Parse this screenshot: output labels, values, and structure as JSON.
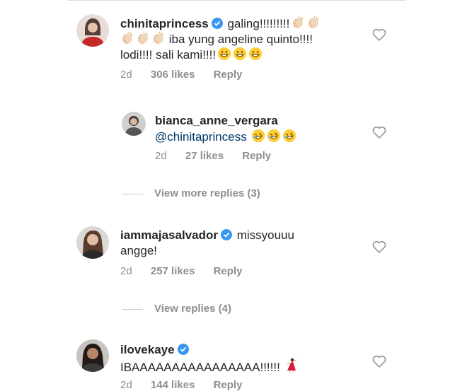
{
  "comments": [
    {
      "username": "chinitaprincess",
      "verified": true,
      "text_line1": "galing!!!!!!!!!",
      "text_line2": "iba yung angeline quinto!!!!",
      "text_line3": "lodi!!!! sali kami!!!!",
      "time": "2d",
      "likes": "306 likes",
      "reply": "Reply"
    },
    {
      "username": "bianca_anne_vergara",
      "verified": false,
      "mention": "@chinitaprincess",
      "time": "2d",
      "likes": "27 likes",
      "reply": "Reply"
    },
    {
      "username": "iammajasalvador",
      "verified": true,
      "text_line1": "missyouuu",
      "text_line2": "angge!",
      "time": "2d",
      "likes": "257 likes",
      "reply": "Reply"
    },
    {
      "username": "ilovekaye",
      "verified": true,
      "text_line1": "IBAAAAAAAAAAAAAAAA!!!!!!",
      "time": "2d",
      "likes": "144 likes",
      "reply": "Reply"
    }
  ],
  "view_more_replies": "View more replies (3)",
  "view_replies": "View replies (4)",
  "icons": {
    "verified": "verified-badge-icon",
    "heart": "heart-outline-icon",
    "clap": "clapping-hands-emoji",
    "grin": "grinning-face-emoji",
    "rofl": "rolling-laughing-emoji",
    "dancer": "dancing-woman-emoji"
  },
  "colors": {
    "verified": "#3897f0",
    "meta": "#8e8e8e",
    "mention": "#00376b"
  }
}
